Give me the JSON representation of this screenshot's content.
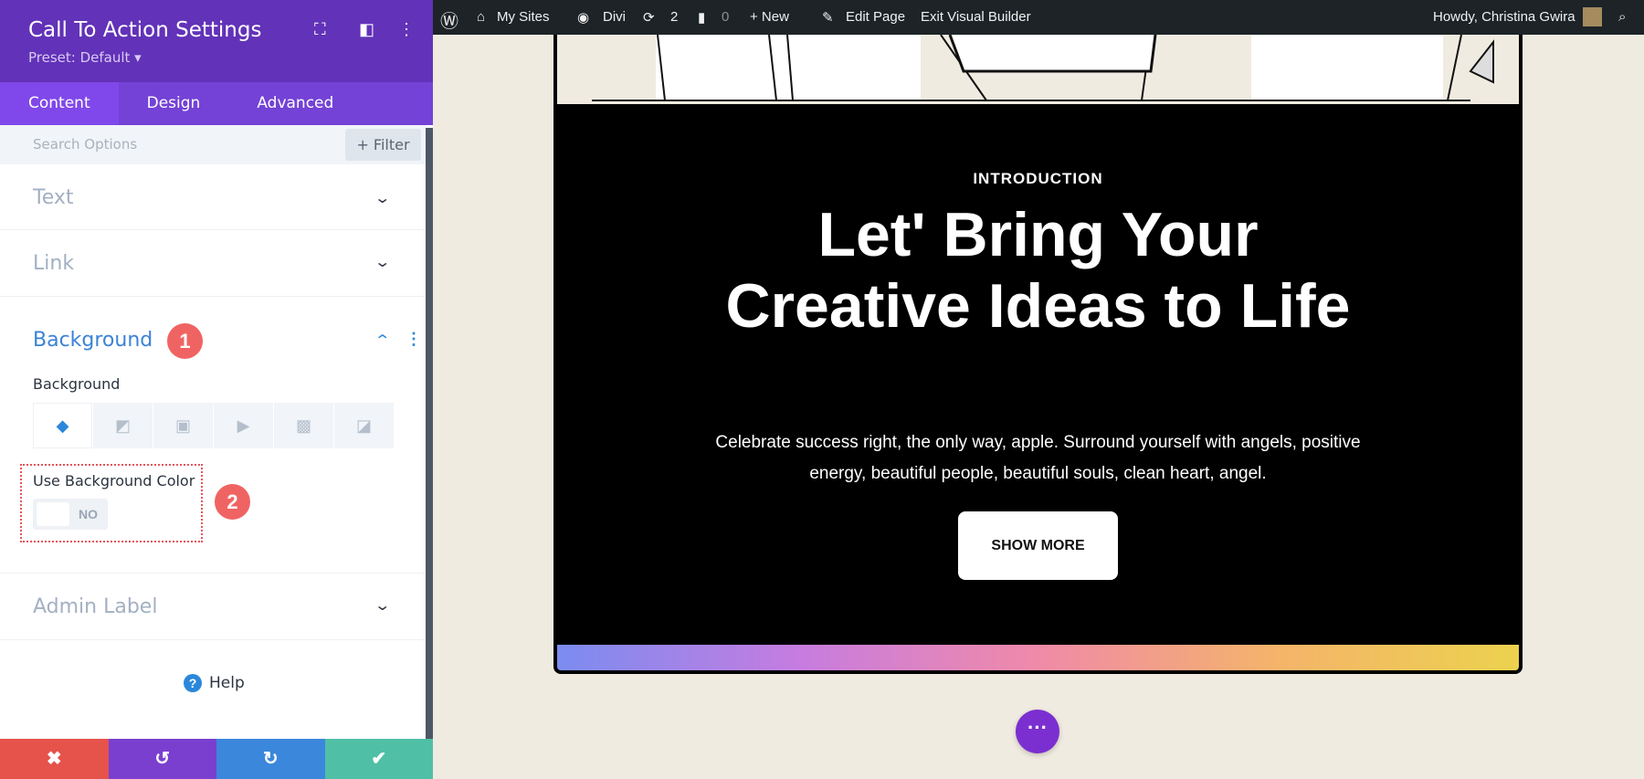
{
  "sidebar": {
    "title": "Call To Action Settings",
    "preset": "Preset: Default ▾",
    "tabs": [
      "Content",
      "Design",
      "Advanced"
    ],
    "search_placeholder": "Search Options",
    "filter_label": "+ Filter",
    "sections": {
      "text": "Text",
      "link": "Link",
      "background": "Background",
      "admin": "Admin Label"
    },
    "background_label": "Background",
    "use_bg_color": "Use Background Color",
    "toggle_value": "NO",
    "badges": [
      "1",
      "2"
    ],
    "help": "Help"
  },
  "adminbar": {
    "my_sites": "My Sites",
    "divi": "Divi",
    "updates": "2",
    "comments": "0",
    "new": "+ New",
    "edit": "Edit Page",
    "exit": "Exit Visual Builder",
    "howdy": "Howdy, Christina Gwira"
  },
  "page": {
    "intro": "INTRODUCTION",
    "heading": "Let' Bring Your Creative Ideas to Life",
    "paragraph": "Celebrate success right, the only way, apple. Surround yourself with angels, positive energy, beautiful people, beautiful souls, clean heart, angel.",
    "button": "SHOW MORE"
  },
  "colors": {
    "purple": "#6232b8",
    "accent": "#2b87da",
    "badge": "#ef6462"
  }
}
